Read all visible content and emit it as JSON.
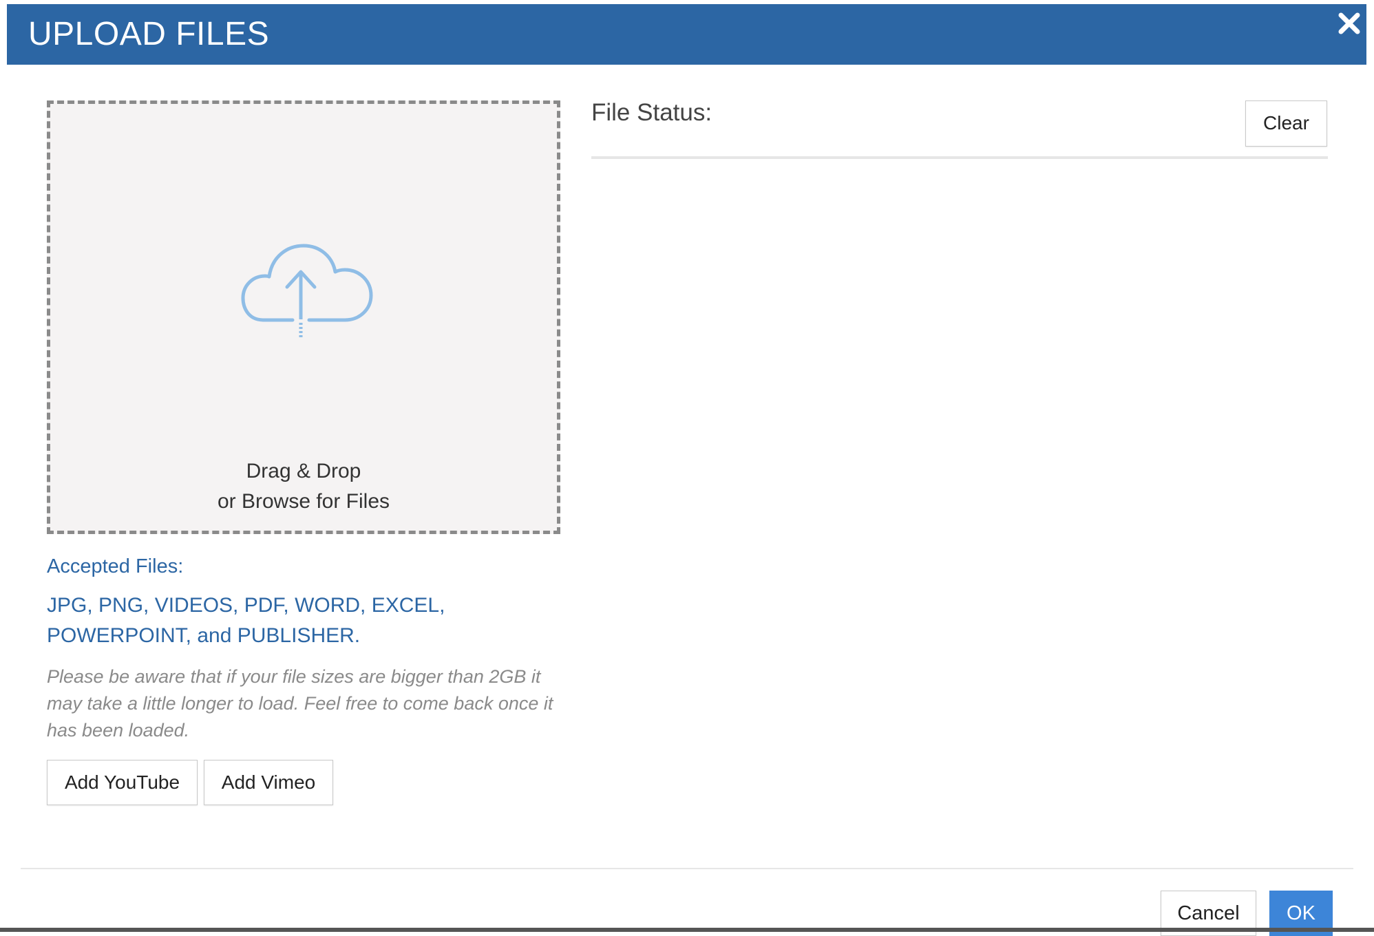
{
  "dialog": {
    "title": "UPLOAD FILES",
    "header_color": "#2c66a4",
    "close_icon": "close-icon"
  },
  "dropzone": {
    "icon": "cloud-upload-icon",
    "icon_color": "#8fbde6",
    "line1": "Drag & Drop",
    "line2": "or Browse for Files"
  },
  "accepted": {
    "label": "Accepted Files:",
    "types_line1": "JPG, PNG, VIDEOS, PDF, WORD, EXCEL,",
    "types_line2": "POWERPOINT, and PUBLISHER.",
    "note": "Please be aware that if your file sizes are bigger than 2GB it may take a little longer to load. Feel free to come back once it has been loaded."
  },
  "buttons": {
    "add_youtube": "Add YouTube",
    "add_vimeo": "Add Vimeo",
    "clear": "Clear",
    "cancel": "Cancel",
    "ok": "OK"
  },
  "status": {
    "label": "File Status:"
  },
  "colors": {
    "accent": "#2c66a4",
    "primary_button": "#3d85d8",
    "muted_text": "#8a8a8a"
  }
}
